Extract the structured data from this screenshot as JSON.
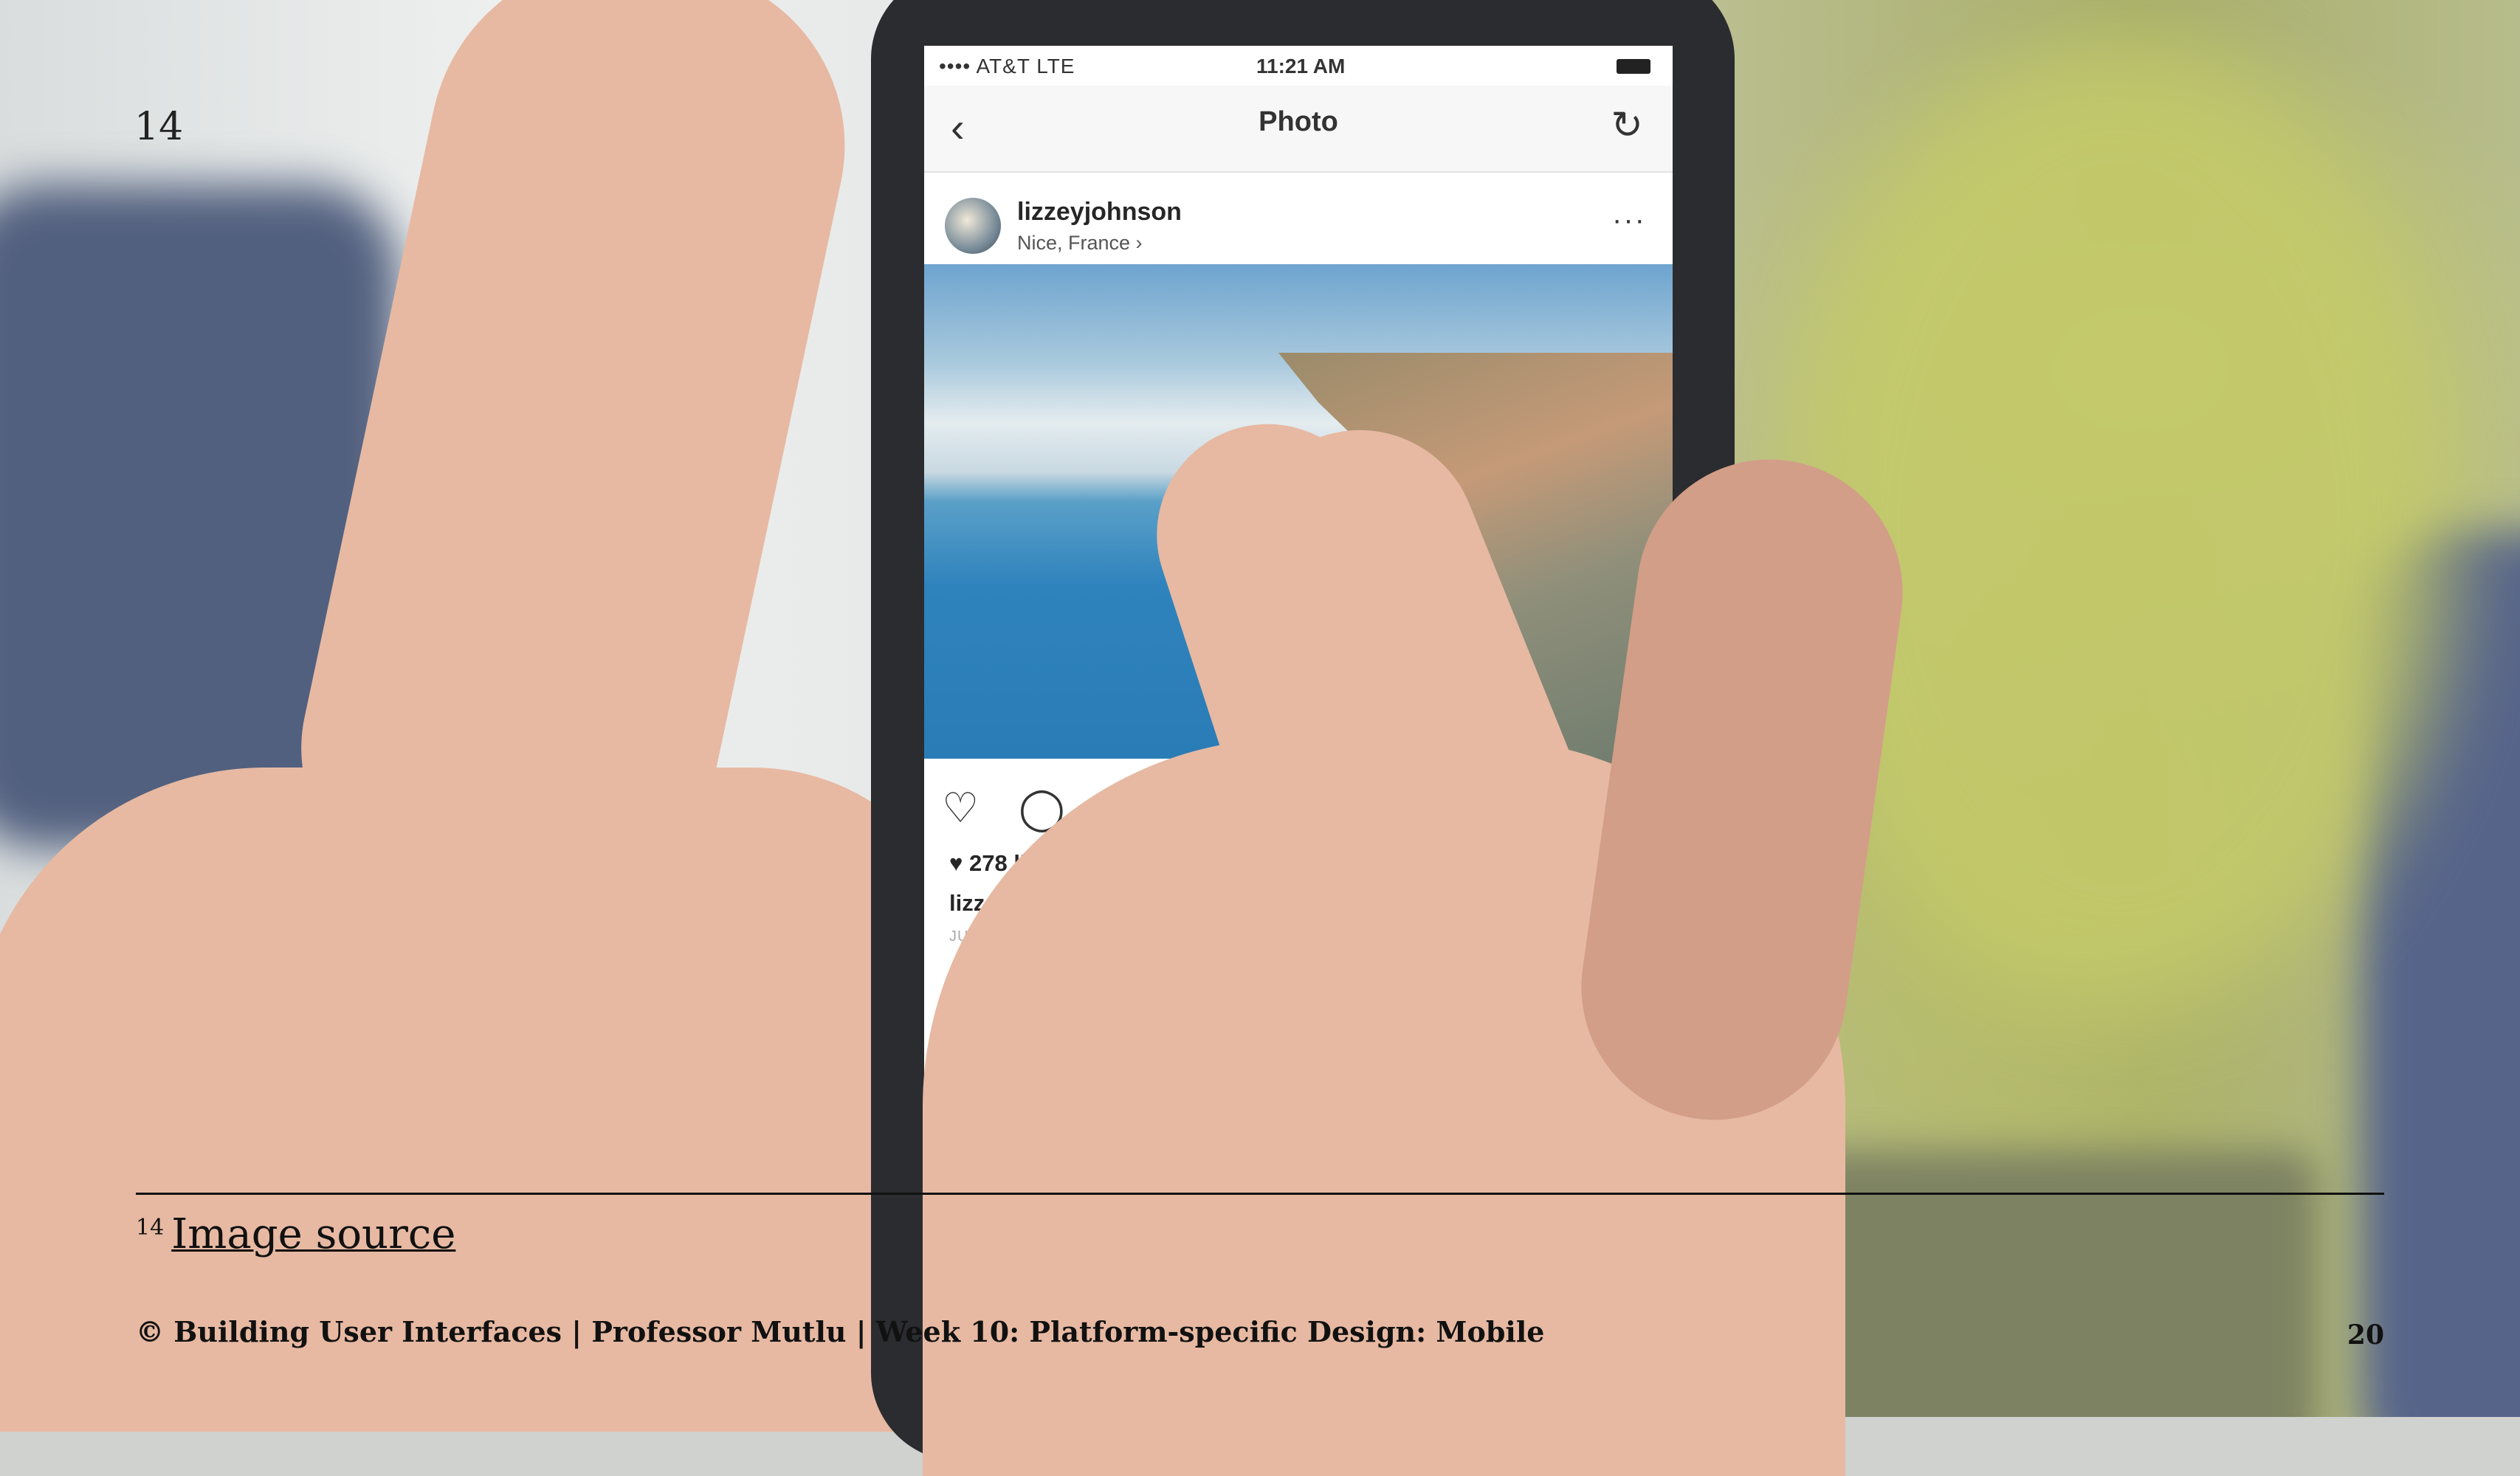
{
  "slide": {
    "section_number": "14",
    "footnote_marker": "14",
    "footnote_link": "Image source",
    "footer_text": "© Building User Interfaces | Professor Mutlu | Week 10: Platform-specific Design: Mobile",
    "page_number": "20"
  },
  "phone": {
    "status": {
      "carrier": "•••• AT&T LTE",
      "time": "11:21 AM"
    },
    "nav": {
      "back_icon": "‹",
      "title": "Photo",
      "refresh_icon": "↻"
    },
    "post": {
      "username": "lizzeyjohnson",
      "location": "Nice, France ›",
      "more_icon": "···",
      "likes": "♥ 278 likes",
      "caption_user": "lizzeyjohnson",
      "date": "JULY 14"
    },
    "actions": {
      "like_icon": "♡",
      "comment_icon": "◯",
      "share_icon": "↷"
    }
  },
  "colors": {
    "foliage": "#b9bf66",
    "skin": "#e7b9a2",
    "phone_body": "#2b2c30",
    "sea": "#2f83bd"
  }
}
